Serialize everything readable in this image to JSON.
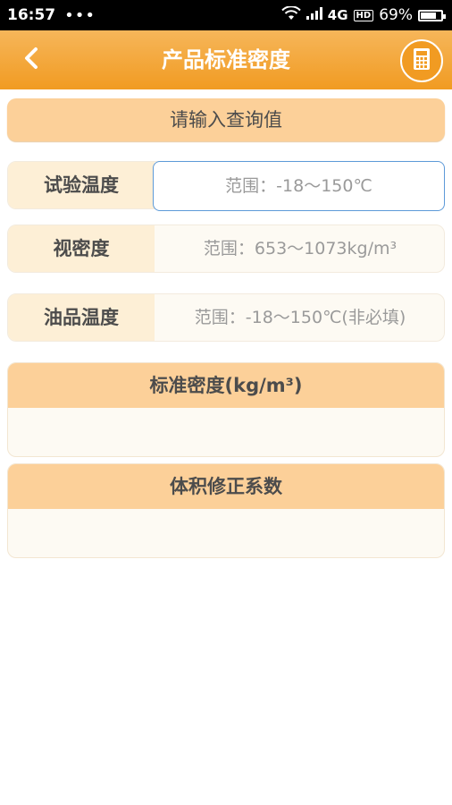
{
  "status_bar": {
    "time": "16:57",
    "dots": "•••",
    "network": "4G",
    "hd": "HD",
    "battery": "69%",
    "battery_level": 0.69
  },
  "header": {
    "title": "产品标准密度",
    "color": "#f19b22"
  },
  "query_banner": "请输入查询值",
  "fields": [
    {
      "label": "试验温度",
      "placeholder": "范围：-18～150℃",
      "value": ""
    },
    {
      "label": "视密度",
      "placeholder": "范围：653～1073kg/m³",
      "value": ""
    },
    {
      "label": "油品温度",
      "placeholder": "范围：-18～150℃(非必填)",
      "value": ""
    }
  ],
  "results": [
    {
      "title": "标准密度(kg/m³)",
      "value": ""
    },
    {
      "title": "体积修正系数",
      "value": ""
    }
  ],
  "icons": {
    "back": "chevron-left-icon",
    "calculator": "calculator-icon",
    "wifi": "wifi-icon",
    "signal": "signal-icon",
    "battery": "battery-icon"
  }
}
